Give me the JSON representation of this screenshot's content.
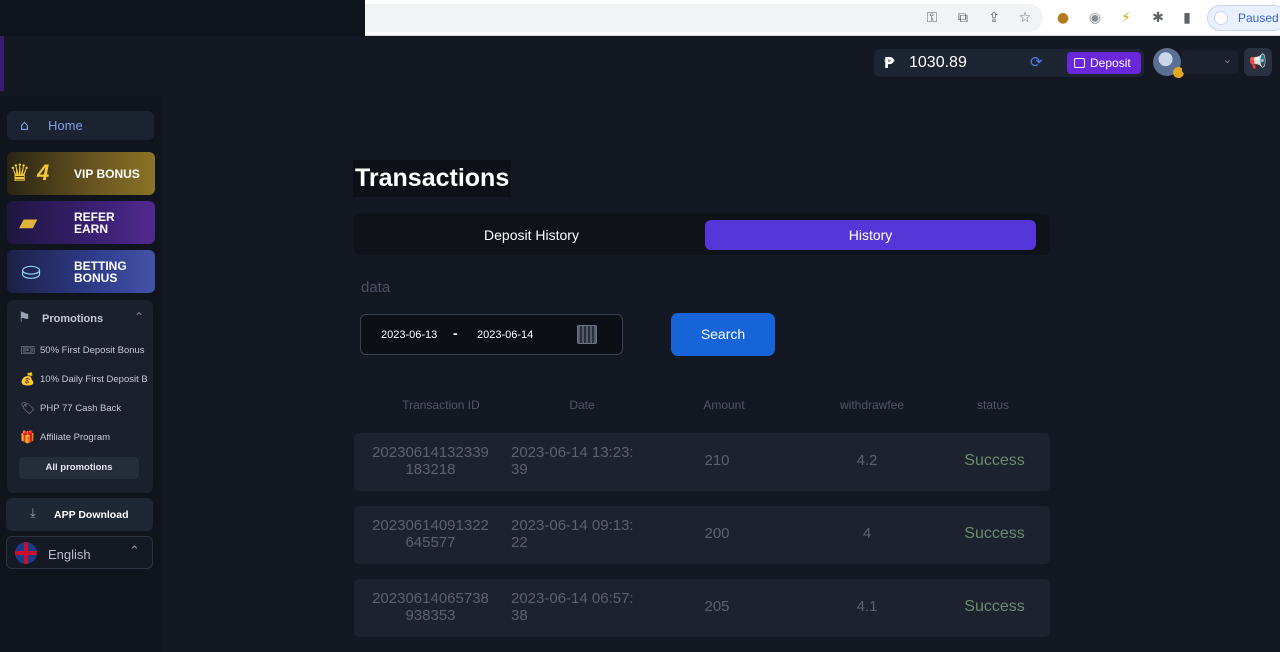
{
  "browser": {
    "paused_label": "Paused",
    "icons": [
      "key-icon",
      "open-in-new-icon",
      "share-icon",
      "bookmark-star-icon",
      "extension-icon",
      "extension-icon",
      "extension-icon",
      "puzzle-icon",
      "sidebar-icon"
    ]
  },
  "header": {
    "currency_symbol": "₱",
    "balance": "1030.89",
    "deposit_label": "Deposit"
  },
  "sidebar": {
    "home_label": "Home",
    "vip_level": "4",
    "vip_label": "VIP BONUS",
    "refer_line1": "REFER",
    "refer_line2": "EARN",
    "bet_line1": "BETTING",
    "bet_line2": "BONUS",
    "promotions_label": "Promotions",
    "promo_items": [
      {
        "label": "50% First Deposit Bonus",
        "icon": "ticket-icon"
      },
      {
        "label": "10% Daily First Deposit B",
        "icon": "money-bag-icon"
      },
      {
        "label": "PHP 77 Cash Back",
        "icon": "tag-icon"
      },
      {
        "label": "Affiliate Program",
        "icon": "gift-icon"
      }
    ],
    "all_promotions_label": "All promotions",
    "app_download_label": "APP Download",
    "language_label": "English"
  },
  "main": {
    "title": "Transactions",
    "tabs": [
      {
        "label": "Deposit History",
        "active": false
      },
      {
        "label": "History",
        "active": true
      }
    ],
    "filter_label": "data",
    "date_start": "2023-06-13",
    "date_separator": "-",
    "date_end": "2023-06-14",
    "search_label": "Search",
    "columns": [
      "Transaction ID",
      "Date",
      "Amount",
      "withdrawfee",
      "status"
    ],
    "rows": [
      {
        "id_line1": "20230614132339",
        "id_line2": "183218",
        "date_line1": "2023-06-14 13:23:",
        "date_line2": "39",
        "amount": "210",
        "fee": "4.2",
        "status": "Success"
      },
      {
        "id_line1": "20230614091322",
        "id_line2": "645577",
        "date_line1": "2023-06-14 09:13:",
        "date_line2": "22",
        "amount": "200",
        "fee": "4",
        "status": "Success"
      },
      {
        "id_line1": "20230614065738",
        "id_line2": "938353",
        "date_line1": "2023-06-14 06:57:",
        "date_line2": "38",
        "amount": "205",
        "fee": "4.1",
        "status": "Success"
      }
    ]
  },
  "colors": {
    "accent_purple": "#5536d8",
    "deposit_purple": "#6a26d9",
    "search_blue": "#1763d8",
    "status_success": "#6c8b70",
    "background": "#131822"
  }
}
